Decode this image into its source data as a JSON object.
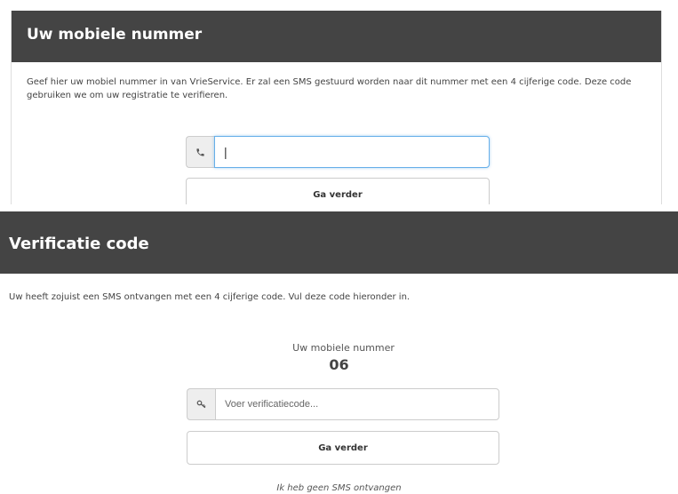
{
  "mobile_panel": {
    "title": "Uw mobiele nummer",
    "intro": "Geef hier uw mobiel nummer in van VrieService. Er zal een SMS gestuurd worden naar dit nummer met een 4 cijferige code. Deze code gebruiken we om uw registratie te verifieren.",
    "phone_value": "",
    "continue_label": "Ga verder",
    "icon": "phone-icon"
  },
  "verify_panel": {
    "title": "Verificatie code",
    "intro": "Uw heeft zojuist een SMS ontvangen met een 4 cijferige code. Vul deze code hieronder in.",
    "number_label": "Uw mobiele nummer",
    "number_value": "06",
    "code_placeholder": "Voer verificatiecode...",
    "continue_label": "Ga verder",
    "no_sms_link": "Ik heb geen SMS ontvangen",
    "icon": "key-icon"
  },
  "colors": {
    "header_bg": "#444444",
    "focus_border": "#66afe9"
  }
}
